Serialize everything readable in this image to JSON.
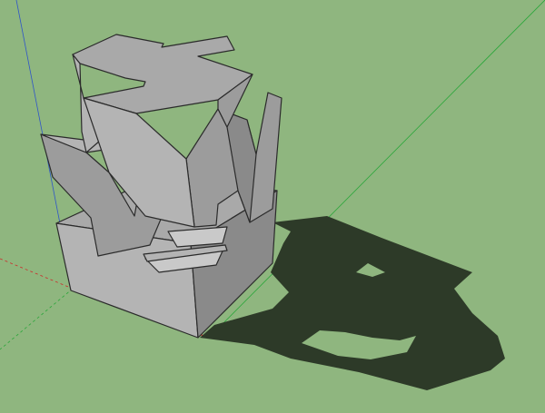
{
  "viewport": {
    "background": "#8fb67f",
    "shadow_color": "#2d3a28",
    "axis_colors": {
      "red": "#cc2b2b",
      "green": "#2aa63a",
      "blue": "#2f55c8"
    },
    "model": {
      "object": "extruded-zigzag-sculpture-on-box",
      "face_colors": [
        "#a9a9a9",
        "#b4b4b4",
        "#9c9c9c",
        "#8a8a8a",
        "#c9c9c9"
      ]
    }
  }
}
